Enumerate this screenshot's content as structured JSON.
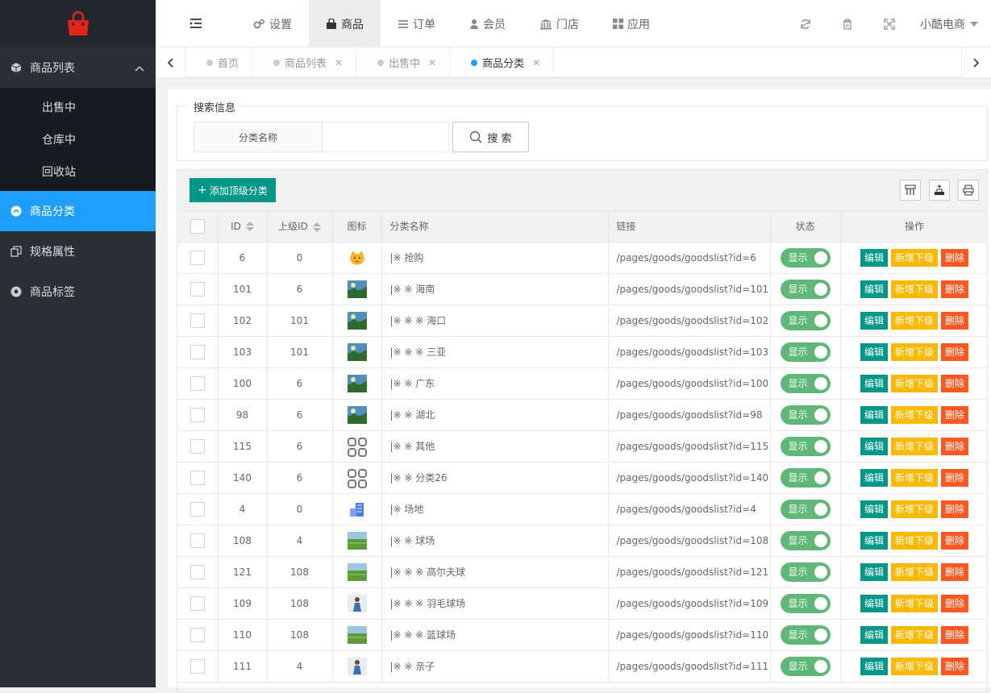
{
  "sidebar": {
    "groups": [
      {
        "label": "商品列表",
        "icon": "cube-icon",
        "expanded": true,
        "items": [
          {
            "label": "出售中"
          },
          {
            "label": "仓库中"
          },
          {
            "label": "回收站"
          }
        ]
      },
      {
        "label": "商品分类",
        "icon": "circle-up-icon",
        "active": true
      },
      {
        "label": "规格属性",
        "icon": "copy-icon"
      },
      {
        "label": "商品标签",
        "icon": "football-icon"
      }
    ]
  },
  "topbar": {
    "menu": [
      {
        "label": "设置",
        "icon": "gears-icon"
      },
      {
        "label": "商品",
        "icon": "bag-icon",
        "active": true
      },
      {
        "label": "订单",
        "icon": "list-icon"
      },
      {
        "label": "会员",
        "icon": "user-icon"
      },
      {
        "label": "门店",
        "icon": "bank-icon"
      },
      {
        "label": "应用",
        "icon": "grid-icon"
      }
    ],
    "user": "小酷电商"
  },
  "tabs": [
    {
      "label": "首页",
      "closable": false
    },
    {
      "label": "商品列表",
      "closable": true
    },
    {
      "label": "出售中",
      "closable": true
    },
    {
      "label": "商品分类",
      "closable": true,
      "active": true
    }
  ],
  "search": {
    "legend": "搜索信息",
    "label": "分类名称",
    "value": "",
    "button": "搜 索"
  },
  "toolbar": {
    "add_label": "添加顶级分类"
  },
  "table": {
    "headers": {
      "id": "ID",
      "parent": "上级ID",
      "icon": "图标",
      "name": "分类名称",
      "link": "链接",
      "status": "状态",
      "ops": "操作"
    },
    "switch_label": "显示",
    "actions": {
      "edit": "编辑",
      "add": "新增下级",
      "del": "删除"
    },
    "rows": [
      {
        "id": "6",
        "parent": "0",
        "name": "|※ 抢购",
        "link": "/pages/goods/goodslist?id=6",
        "thumb": "cat"
      },
      {
        "id": "101",
        "parent": "6",
        "name": "|※ ※ 海南",
        "link": "/pages/goods/goodslist?id=101",
        "thumb": "photo"
      },
      {
        "id": "102",
        "parent": "101",
        "name": "|※ ※ ※ 海口",
        "link": "/pages/goods/goodslist?id=102",
        "thumb": "photo"
      },
      {
        "id": "103",
        "parent": "101",
        "name": "|※ ※ ※ 三亚",
        "link": "/pages/goods/goodslist?id=103",
        "thumb": "photo"
      },
      {
        "id": "100",
        "parent": "6",
        "name": "|※ ※ 广东",
        "link": "/pages/goods/goodslist?id=100",
        "thumb": "photo"
      },
      {
        "id": "98",
        "parent": "6",
        "name": "|※ ※ 湖北",
        "link": "/pages/goods/goodslist?id=98",
        "thumb": "photo"
      },
      {
        "id": "115",
        "parent": "6",
        "name": "|※ ※ 其他",
        "link": "/pages/goods/goodslist?id=115",
        "thumb": "grid"
      },
      {
        "id": "140",
        "parent": "6",
        "name": "|※ ※ 分类26",
        "link": "/pages/goods/goodslist?id=140",
        "thumb": "grid"
      },
      {
        "id": "4",
        "parent": "0",
        "name": "|※ 场地",
        "link": "/pages/goods/goodslist?id=4",
        "thumb": "building"
      },
      {
        "id": "108",
        "parent": "4",
        "name": "|※ ※ 球场",
        "link": "/pages/goods/goodslist?id=108",
        "thumb": "field"
      },
      {
        "id": "121",
        "parent": "108",
        "name": "|※ ※ ※ 高尔夫球",
        "link": "/pages/goods/goodslist?id=121",
        "thumb": "field"
      },
      {
        "id": "109",
        "parent": "108",
        "name": "|※ ※ ※ 羽毛球场",
        "link": "/pages/goods/goodslist?id=109",
        "thumb": "person"
      },
      {
        "id": "110",
        "parent": "108",
        "name": "|※ ※ ※ 篮球场",
        "link": "/pages/goods/goodslist?id=110",
        "thumb": "field"
      },
      {
        "id": "111",
        "parent": "4",
        "name": "|※ ※ 亲子",
        "link": "/pages/goods/goodslist?id=111",
        "thumb": "person"
      }
    ]
  }
}
